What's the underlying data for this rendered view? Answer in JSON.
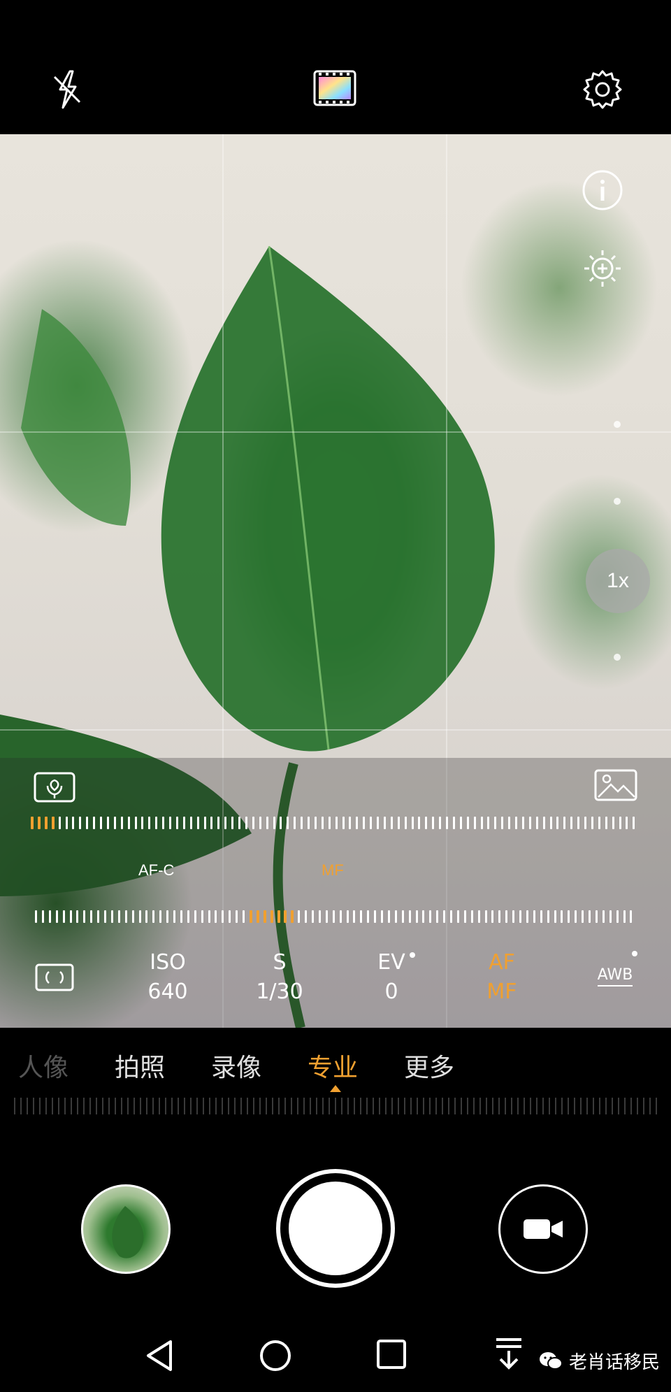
{
  "top_bar": {
    "flash_icon": "flash-off-icon",
    "filter_icon": "color-filter-icon",
    "settings_icon": "gear-icon"
  },
  "viewfinder": {
    "info_icon": "info-icon",
    "brightness_icon": "brightness-plus-icon",
    "zoom_label": "1x"
  },
  "pro_controls": {
    "metering_icon": "macro-flower-icon",
    "gallery_preview_icon": "image-icon",
    "focus_mode_left": "AF-C",
    "focus_mode_active": "MF",
    "params": [
      {
        "label": "ISO",
        "value": "640"
      },
      {
        "label": "S",
        "value": "1/30"
      },
      {
        "label": "EV",
        "value": "0"
      },
      {
        "label": "AF",
        "value": "MF"
      },
      {
        "label": "AWB",
        "value": ""
      }
    ],
    "accent_color": "#f0a030"
  },
  "modes": {
    "items": [
      "人像",
      "拍照",
      "录像",
      "专业",
      "更多"
    ],
    "active": "专业"
  },
  "bottom_controls": {
    "gallery_thumb": "gallery-thumbnail",
    "shutter": "shutter-button",
    "video": "video-camera-icon"
  },
  "navigation": {
    "back": "back-triangle-icon",
    "home": "home-circle-icon",
    "recents": "recents-square-icon",
    "notification": "pull-down-icon"
  },
  "watermark": {
    "text": "老肖话移民",
    "icon": "wechat-icon"
  }
}
